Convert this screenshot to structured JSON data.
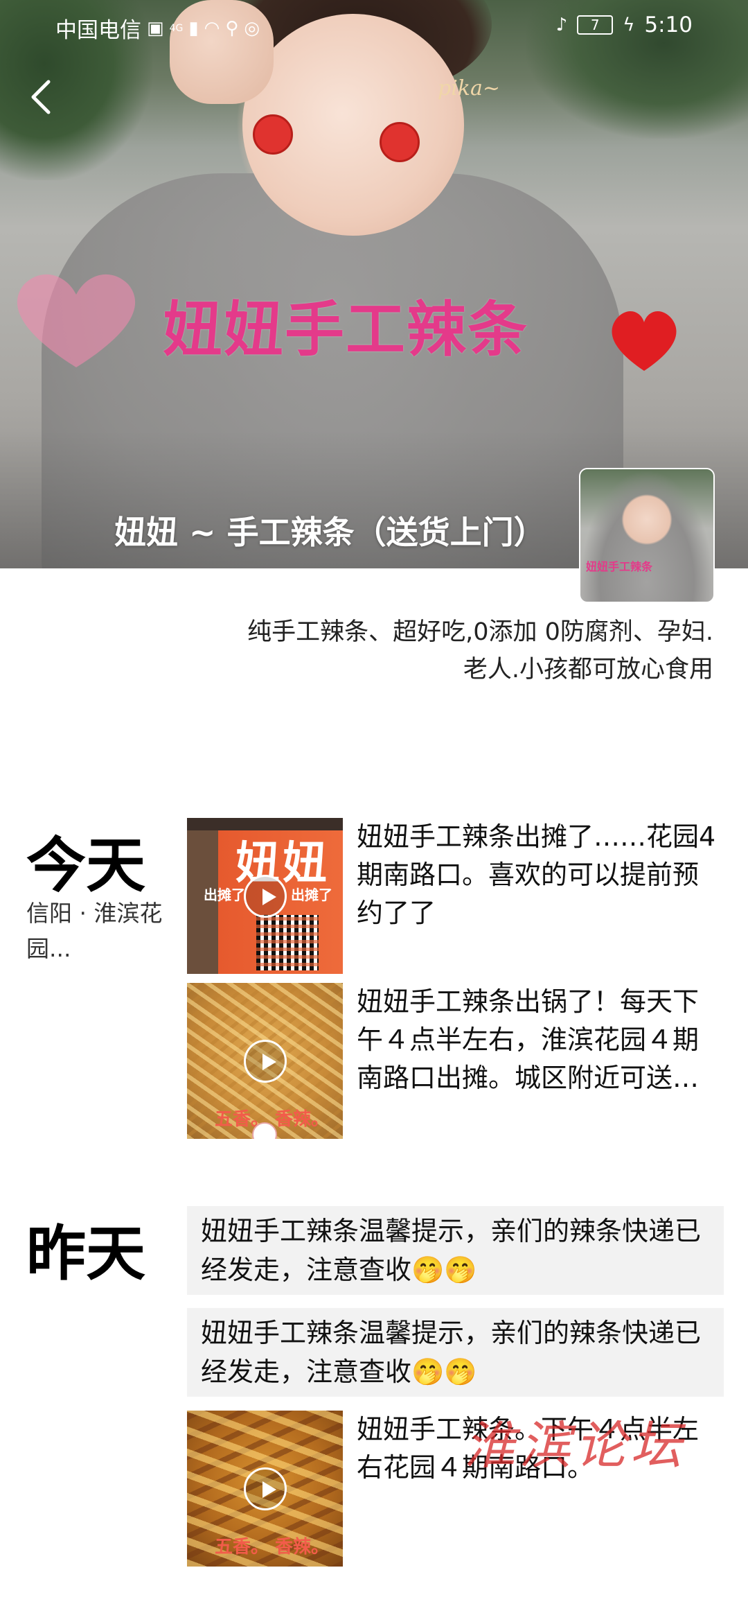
{
  "status_bar": {
    "carrier": "中国电信",
    "network": "4G",
    "time": "5:10",
    "battery": "7",
    "icons": [
      "hd-icon",
      "signal-icon",
      "wifi-icon",
      "search-icon",
      "wechat-icon",
      "mute-icon",
      "battery-icon",
      "charging-icon"
    ]
  },
  "cover": {
    "overlay_text": "妞妞手工辣条",
    "doodle_text": "pika~",
    "title": "妞妞 ~ 手工辣条（送货上门）",
    "avatar_text": "妞妞手工辣条"
  },
  "signature": {
    "line1": "纯手工辣条、超好吃,0添加 0防腐剂、孕妇.",
    "line2": "老人.小孩都可放心食用"
  },
  "feed": {
    "today": {
      "label": "今天",
      "location": "信阳 · 淮滨花园...",
      "entries": [
        {
          "text": "妞妞手工辣条出摊了……花园4期南路口。喜欢的可以提前预约了了",
          "thumb_banner": "妞妞",
          "thumb_caption_a": "出摊了",
          "thumb_caption_b": "出摊了"
        },
        {
          "text": "妞妞手工辣条出锅了！每天下午４点半左右，淮滨花园４期南路口出摊。城区附近可送货上门",
          "thumb_caption": "五香。 香辣。"
        }
      ]
    },
    "yesterday": {
      "label": "昨天",
      "entries": [
        {
          "text": "妞妞手工辣条温馨提示，亲们的辣条快递已经发走，注意查收🤭🤭"
        },
        {
          "text": "妞妞手工辣条温馨提示，亲们的辣条快递已经发走，注意查收🤭🤭"
        },
        {
          "text": "妞妞手工辣条。下午４点半左右花园４期南路口。",
          "thumb_caption": "五香。 香辣。"
        }
      ]
    }
  },
  "watermark": "淮滨论坛"
}
